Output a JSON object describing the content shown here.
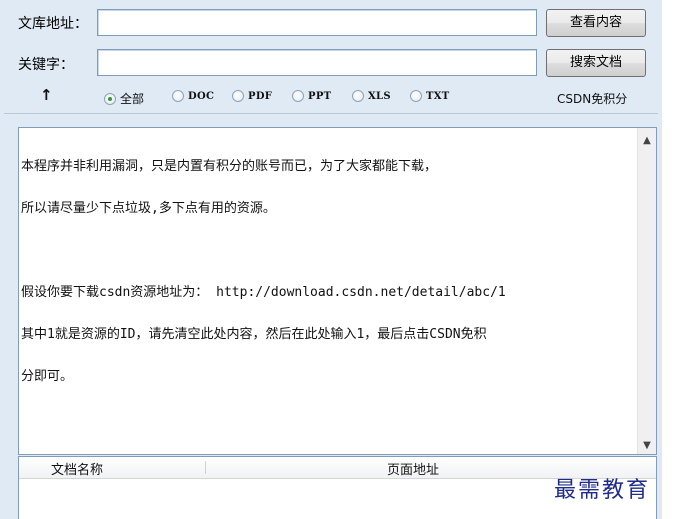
{
  "form": {
    "url_label": "文库地址：",
    "url_value": "",
    "view_button": "查看内容",
    "keyword_label": "关键字：",
    "keyword_value": "",
    "search_button": "搜索文档"
  },
  "filters": {
    "arrow": "↑",
    "options": [
      {
        "label": "全部",
        "selected": true
      },
      {
        "label": "DOC",
        "selected": false
      },
      {
        "label": "PDF",
        "selected": false
      },
      {
        "label": "PPT",
        "selected": false
      },
      {
        "label": "XLS",
        "selected": false
      },
      {
        "label": "TXT",
        "selected": false
      }
    ],
    "csdn_label": "CSDN免积分"
  },
  "memo": {
    "lines": [
      "本程序并非利用漏洞，只是内置有积分的账号而已，为了大家都能下载，",
      "所以请尽量少下点垃圾,多下点有用的资源。",
      "",
      "假设你要下载csdn资源地址为： http://download.csdn.net/detail/abc/1",
      "其中1就是资源的ID，请先清空此处内容，然后在此处输入1，最后点击CSDN免积",
      "分即可。"
    ]
  },
  "list": {
    "columns": [
      "文档名称",
      "页面地址"
    ],
    "rows": []
  },
  "watermark": "最需教育"
}
